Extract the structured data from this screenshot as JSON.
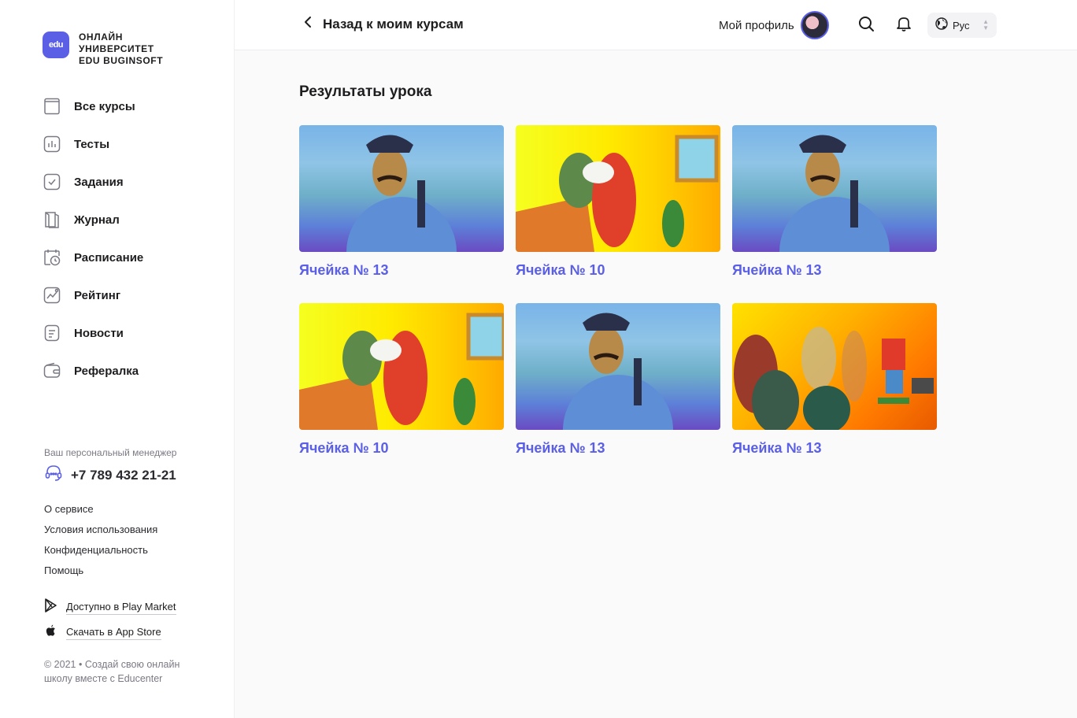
{
  "brand": {
    "badge": "edu",
    "name_line1": "ОНЛАЙН",
    "name_line2": "УНИВЕРСИТЕТ",
    "name_line3": "EDU BUGINSOFT",
    "accent": "#5b5fe6"
  },
  "sidebar": {
    "items": [
      {
        "label": "Все курсы",
        "icon": "book-icon"
      },
      {
        "label": "Тесты",
        "icon": "bar-chart-icon"
      },
      {
        "label": "Задания",
        "icon": "checkbox-icon"
      },
      {
        "label": "Журнал",
        "icon": "journal-icon"
      },
      {
        "label": "Расписание",
        "icon": "calendar-clock-icon"
      },
      {
        "label": "Рейтинг",
        "icon": "trend-chart-icon"
      },
      {
        "label": "Новости",
        "icon": "news-icon"
      },
      {
        "label": "Рефералка",
        "icon": "wallet-icon"
      }
    ],
    "manager_caption": "Ваш персональный  менеджер",
    "manager_phone": "+7 789 432 21-21",
    "links": [
      "О сервисе",
      "Условия использования",
      "Конфиденциальность",
      "Помощь"
    ],
    "play_market": "Доступно в Play Market",
    "app_store": "Скачать в App Store",
    "copyright": "© 2021 • Создай свою онлайн школу вместе с Educenter"
  },
  "header": {
    "back_label": "Назад к моим курсам",
    "profile_label": "Мой профиль",
    "language": "Рус"
  },
  "main": {
    "title": "Результаты  урока",
    "cards": [
      {
        "title": "Ячейка № 13",
        "scene": "police"
      },
      {
        "title": "Ячейка № 10",
        "scene": "family"
      },
      {
        "title": "Ячейка № 13",
        "scene": "police"
      },
      {
        "title": "Ячейка № 10",
        "scene": "family"
      },
      {
        "title": "Ячейка № 13",
        "scene": "police"
      },
      {
        "title": "Ячейка № 13",
        "scene": "show"
      }
    ]
  }
}
